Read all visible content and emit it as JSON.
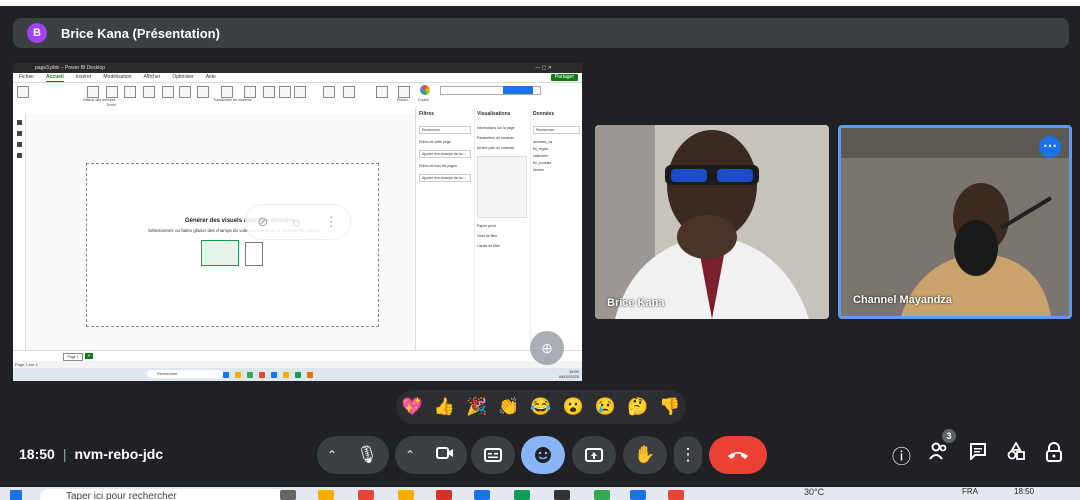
{
  "presenter": {
    "initial": "B",
    "label": "Brice Kana (Présentation)"
  },
  "shared_screen": {
    "window_title": "page3.pbix – Power BI Desktop",
    "menu": [
      "Fichier",
      "Accueil",
      "Insérer",
      "Modélisation",
      "Afficher",
      "Optimiser",
      "Aide"
    ],
    "share_label": "Partager",
    "ribbon_labels": [
      "Obtenir des données",
      "Excel",
      "Hub de données",
      "SQL Server",
      "Entrer des données",
      "Dataverse",
      "Sources récentes",
      "Transformer les données",
      "Actualiser",
      "Nouveau visuel",
      "Zone de texte",
      "Plus de visuels",
      "Nouvelle mesure",
      "Mesure rapide",
      "Sensibilité",
      "Publier",
      "Copilot"
    ],
    "canvas_title": "Générer des visuels avec vos données",
    "canvas_subtitle": "Sélectionnez ou faites glisser des champs du volet Données sur le canevas de rapport",
    "pane_filters": "Filtres",
    "pane_visualizations": "Visualisations",
    "pane_data": "Données",
    "filter_search": "Rechercher",
    "filter_items": [
      "Filtres de cette page",
      "Ajouter des champs de do...",
      "Filtres de tous les pages",
      "Ajouter des champs de do..."
    ],
    "viz_items": [
      "Informations sur la page",
      "Paramètres du canevas",
      "Arrière-plan du canevas",
      "Papier peint",
      "Volet de filtre",
      "Cartes de filtre"
    ],
    "data_items": [
      "donnees_ca",
      "tbl_region",
      "calendrier",
      "tbl_produits",
      "Ventes"
    ],
    "page_tab": "Page 1",
    "page_count": "Page 1 sur 1",
    "taskbar_search": "Rechercher",
    "taskbar_time": "18:50",
    "taskbar_date": "04/02/2025"
  },
  "overlay_icons": [
    "pin-off-icon",
    "eye-off-icon",
    "more-vert-icon"
  ],
  "participants": [
    {
      "name": "Brice Kana"
    },
    {
      "name": "Channel Mayandza"
    }
  ],
  "reactions": [
    "💖",
    "👍",
    "🎉",
    "👏",
    "😂",
    "😮",
    "😢",
    "🤔",
    "👎"
  ],
  "meeting": {
    "time": "18:50",
    "code": "nvm-rebo-jdc"
  },
  "participant_count": "3",
  "os_taskbar": {
    "search_placeholder": "Taper ici pour rechercher",
    "weather": "30°C",
    "lang": "FRA",
    "time": "18:50"
  }
}
